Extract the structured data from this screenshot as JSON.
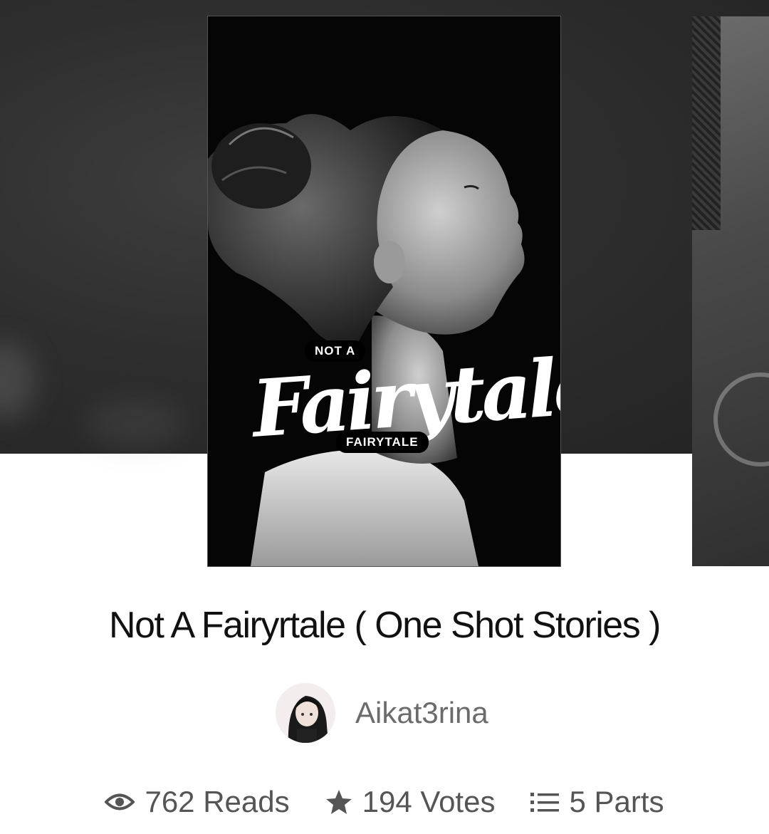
{
  "cover": {
    "small_label": "NOT A",
    "script_word": "Fairytale",
    "bottom_label": "FAIRYTALE"
  },
  "story": {
    "title": "Not A Fairyrtale ( One Shot Stories )",
    "author": "Aikat3rina"
  },
  "stats": {
    "reads": "762 Reads",
    "votes": "194 Votes",
    "parts": "5 Parts"
  },
  "icons": {
    "reads": "eye-icon",
    "votes": "star-icon",
    "parts": "list-icon"
  },
  "colors": {
    "hero_background": "#2b2b2b",
    "title_text": "#111111",
    "muted_text": "#555555"
  }
}
